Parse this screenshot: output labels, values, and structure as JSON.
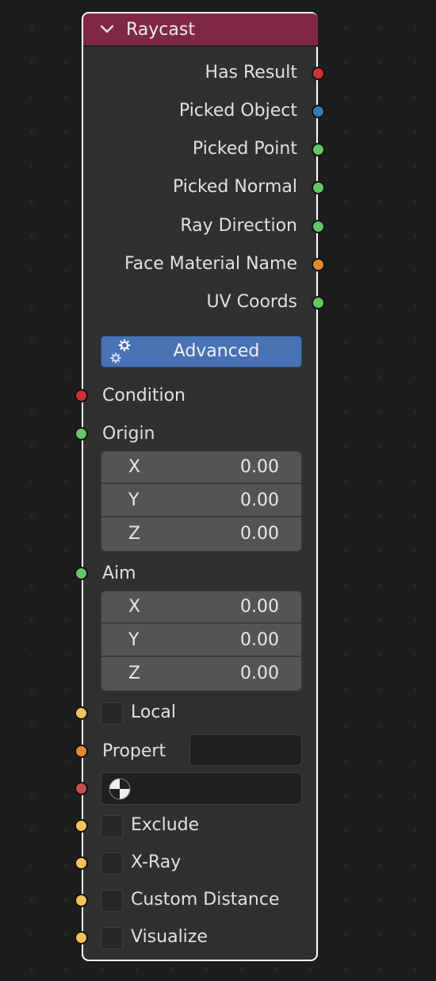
{
  "node": {
    "title": "Raycast",
    "header_color": "#7f2845",
    "outputs": [
      {
        "label": "Has Result",
        "socket_color": "#c83232"
      },
      {
        "label": "Picked Object",
        "socket_color": "#3a78b0"
      },
      {
        "label": "Picked Point",
        "socket_color": "#63c763"
      },
      {
        "label": "Picked Normal",
        "socket_color": "#63c763"
      },
      {
        "label": "Ray Direction",
        "socket_color": "#63c763"
      },
      {
        "label": "Face Material Name",
        "socket_color": "#e08a32"
      },
      {
        "label": "UV Coords",
        "socket_color": "#63c763"
      }
    ],
    "advanced_button": {
      "label": "Advanced",
      "icon": "gears-icon"
    },
    "inputs": {
      "condition": {
        "label": "Condition",
        "socket_color": "#c83232"
      },
      "origin": {
        "label": "Origin",
        "socket_color": "#63c763",
        "fields": [
          {
            "axis": "X",
            "value": "0.00"
          },
          {
            "axis": "Y",
            "value": "0.00"
          },
          {
            "axis": "Z",
            "value": "0.00"
          }
        ]
      },
      "aim": {
        "label": "Aim",
        "socket_color": "#63c763",
        "fields": [
          {
            "axis": "X",
            "value": "0.00"
          },
          {
            "axis": "Y",
            "value": "0.00"
          },
          {
            "axis": "Z",
            "value": "0.00"
          }
        ]
      },
      "local": {
        "label": "Local",
        "socket_color": "#f5c25a",
        "checked": false
      },
      "property": {
        "label": "Propert",
        "socket_color": "#e08a32",
        "value": ""
      },
      "material": {
        "socket_color": "#c05050",
        "icon": "material-ball-icon",
        "value": ""
      },
      "exclude": {
        "label": "Exclude",
        "socket_color": "#f5c25a",
        "checked": false
      },
      "xray": {
        "label": "X-Ray",
        "socket_color": "#f5c25a",
        "checked": false
      },
      "custom_distance": {
        "label": "Custom Distance",
        "socket_color": "#f5c25a",
        "checked": false
      },
      "visualize": {
        "label": "Visualize",
        "socket_color": "#f5c25a",
        "checked": false
      }
    }
  }
}
